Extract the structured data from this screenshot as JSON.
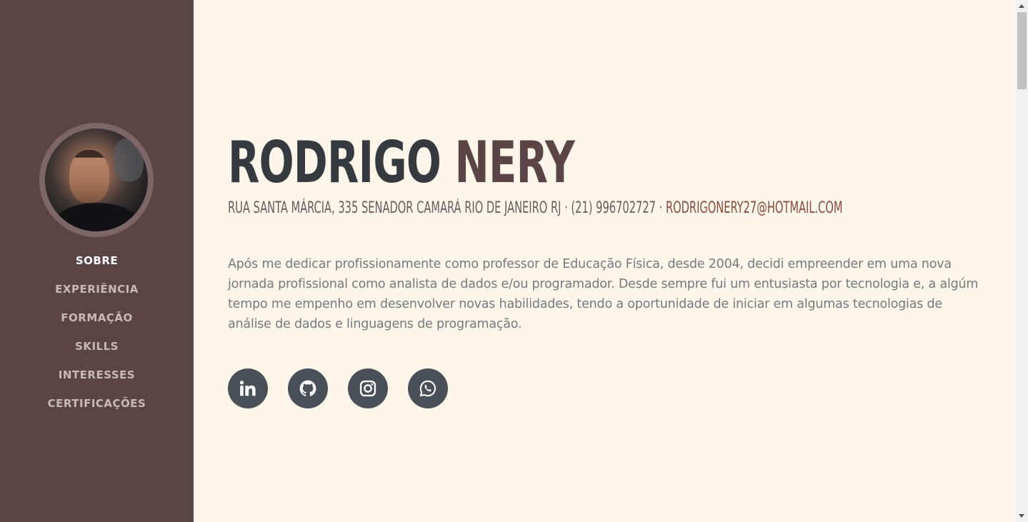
{
  "profile": {
    "first_name": "RODRIGO",
    "last_name": "NERY",
    "address": "RUA SANTA MÁRCIA, 335 SENADOR CAMARÁ RIO DE JANEIRO RJ · (21) 996702727 ·",
    "email": "RODRIGONERY27@HOTMAIL.COM",
    "about": "Após me dedicar profissionamente como professor de Educação Física, desde 2004, decidi empreender em uma nova jornada profissional como analista de dados e/ou programador. Desde sempre fui um entusiasta por tecnologia e, a algúm tempo me empenho em desenvolver novas habilidades, tendo a oportunidade de iniciar em algumas tecnologias de análise de dados e linguagens de programação."
  },
  "nav": {
    "items": [
      {
        "label": "SOBRE"
      },
      {
        "label": "EXPERIÊNCIA"
      },
      {
        "label": "FORMAÇÃO"
      },
      {
        "label": "SKILLS"
      },
      {
        "label": "INTERESSES"
      },
      {
        "label": "CERTIFICAÇÕES"
      }
    ],
    "active": "SOBRE"
  },
  "socials": [
    {
      "icon": "linkedin-icon"
    },
    {
      "icon": "github-icon"
    },
    {
      "icon": "instagram-icon"
    },
    {
      "icon": "whatsapp-icon"
    }
  ],
  "colors": {
    "sidebar": "#5a4446",
    "background": "#fef6ea",
    "name_first": "#343a40",
    "name_last": "#5a4446",
    "email": "#8b4a3c",
    "social_bg": "#495057"
  }
}
